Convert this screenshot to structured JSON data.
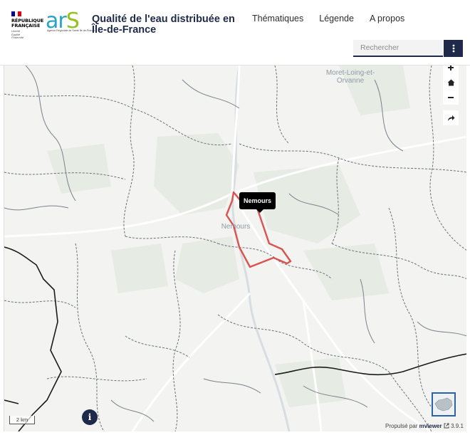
{
  "header": {
    "republique_lines": [
      "RÉPUBLIQUE",
      "FRANÇAISE"
    ],
    "republique_motto": [
      "Liberté",
      "Égalité",
      "Fraternité"
    ],
    "ars_word_a": "ar",
    "ars_word_s": "S",
    "ars_sub": "Agence Régionale de Santé Île-de-France",
    "title": "Qualité de l'eau distribuée en Île-de-France",
    "nav": [
      "Thématiques",
      "Légende",
      "A propos"
    ],
    "search_placeholder": "Rechercher"
  },
  "map": {
    "labels": {
      "moret": "Moret-Loing-et-Orvanne",
      "nemours": "Nemours"
    },
    "tooltip": "Nemours",
    "scale": "2 km",
    "info": "i",
    "attribution_prefix": "Propulsé par",
    "attribution_link": "mviewer",
    "attribution_version": "3.9.1"
  },
  "colors": {
    "brand_dark": "#1f2a4b",
    "commune_outline": "#d9534f",
    "ars_blue": "#2aa3c4",
    "ars_green": "#95c11f"
  }
}
